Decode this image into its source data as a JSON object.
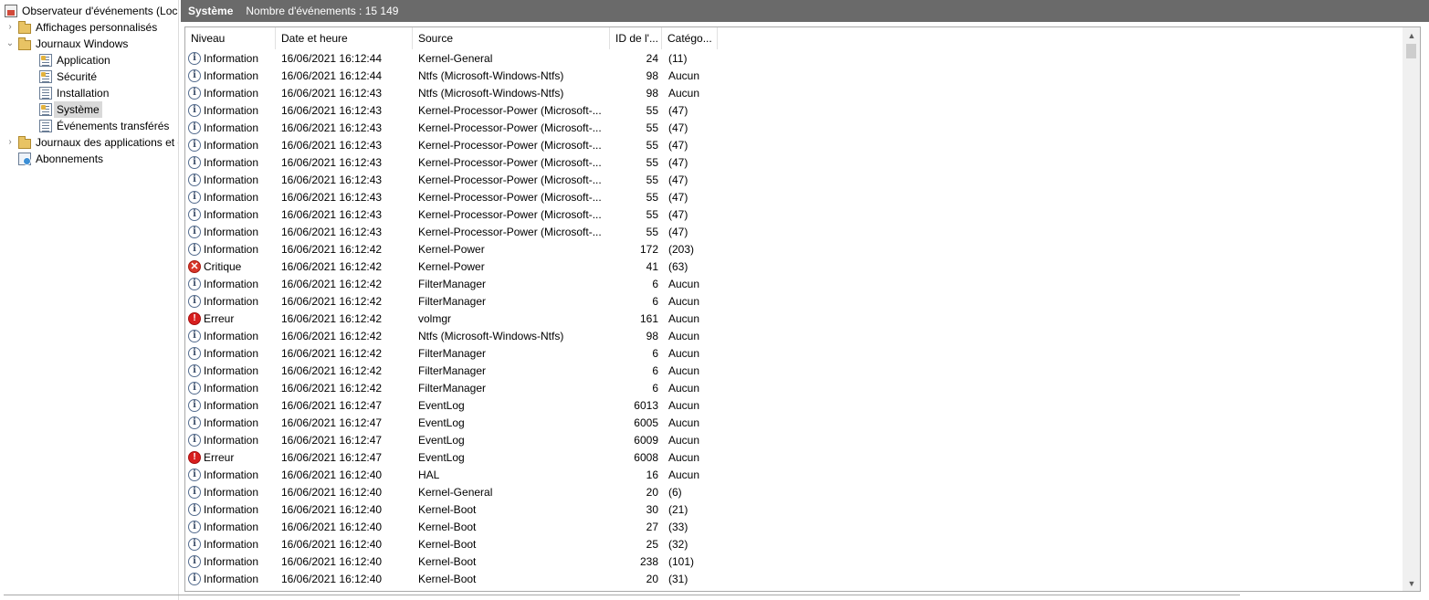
{
  "tree": {
    "items": [
      {
        "label": "Observateur d'événements (Local)",
        "icon": "event-viewer-icon",
        "expander": "",
        "selected": false
      },
      {
        "label": "Affichages personnalisés",
        "icon": "folder-icon",
        "expander": "›",
        "selected": false
      },
      {
        "label": "Journaux Windows",
        "icon": "folder-icon",
        "expander": "⌄",
        "selected": false
      },
      {
        "label": "Application",
        "icon": "log-icon",
        "expander": "",
        "selected": false
      },
      {
        "label": "Sécurité",
        "icon": "log-icon",
        "expander": "",
        "selected": false
      },
      {
        "label": "Installation",
        "icon": "log-icon",
        "expander": "",
        "selected": false
      },
      {
        "label": "Système",
        "icon": "log-icon",
        "expander": "",
        "selected": true
      },
      {
        "label": "Événements transférés",
        "icon": "log-icon",
        "expander": "",
        "selected": false
      },
      {
        "label": "Journaux des applications et des services",
        "icon": "folder-icon",
        "expander": "›",
        "selected": false
      },
      {
        "label": "Abonnements",
        "icon": "subscriptions-icon",
        "expander": "",
        "selected": false
      }
    ]
  },
  "header": {
    "title": "Système",
    "count": "Nombre d'événements : 15 149"
  },
  "columns": {
    "level": "Niveau",
    "date": "Date et heure",
    "source": "Source",
    "id": "ID de l'...",
    "category": "Catégo..."
  },
  "level_icons": {
    "Information": "i",
    "Erreur": "!",
    "Critique": "✕"
  },
  "rows": [
    {
      "level": "Information",
      "date": "16/06/2021 16:12:44",
      "source": "Kernel-General",
      "id": "24",
      "category": "(11)"
    },
    {
      "level": "Information",
      "date": "16/06/2021 16:12:44",
      "source": "Ntfs (Microsoft-Windows-Ntfs)",
      "id": "98",
      "category": "Aucun"
    },
    {
      "level": "Information",
      "date": "16/06/2021 16:12:43",
      "source": "Ntfs (Microsoft-Windows-Ntfs)",
      "id": "98",
      "category": "Aucun"
    },
    {
      "level": "Information",
      "date": "16/06/2021 16:12:43",
      "source": "Kernel-Processor-Power (Microsoft-...",
      "id": "55",
      "category": "(47)"
    },
    {
      "level": "Information",
      "date": "16/06/2021 16:12:43",
      "source": "Kernel-Processor-Power (Microsoft-...",
      "id": "55",
      "category": "(47)"
    },
    {
      "level": "Information",
      "date": "16/06/2021 16:12:43",
      "source": "Kernel-Processor-Power (Microsoft-...",
      "id": "55",
      "category": "(47)"
    },
    {
      "level": "Information",
      "date": "16/06/2021 16:12:43",
      "source": "Kernel-Processor-Power (Microsoft-...",
      "id": "55",
      "category": "(47)"
    },
    {
      "level": "Information",
      "date": "16/06/2021 16:12:43",
      "source": "Kernel-Processor-Power (Microsoft-...",
      "id": "55",
      "category": "(47)"
    },
    {
      "level": "Information",
      "date": "16/06/2021 16:12:43",
      "source": "Kernel-Processor-Power (Microsoft-...",
      "id": "55",
      "category": "(47)"
    },
    {
      "level": "Information",
      "date": "16/06/2021 16:12:43",
      "source": "Kernel-Processor-Power (Microsoft-...",
      "id": "55",
      "category": "(47)"
    },
    {
      "level": "Information",
      "date": "16/06/2021 16:12:43",
      "source": "Kernel-Processor-Power (Microsoft-...",
      "id": "55",
      "category": "(47)"
    },
    {
      "level": "Information",
      "date": "16/06/2021 16:12:42",
      "source": "Kernel-Power",
      "id": "172",
      "category": "(203)"
    },
    {
      "level": "Critique",
      "date": "16/06/2021 16:12:42",
      "source": "Kernel-Power",
      "id": "41",
      "category": "(63)"
    },
    {
      "level": "Information",
      "date": "16/06/2021 16:12:42",
      "source": "FilterManager",
      "id": "6",
      "category": "Aucun"
    },
    {
      "level": "Information",
      "date": "16/06/2021 16:12:42",
      "source": "FilterManager",
      "id": "6",
      "category": "Aucun"
    },
    {
      "level": "Erreur",
      "date": "16/06/2021 16:12:42",
      "source": "volmgr",
      "id": "161",
      "category": "Aucun"
    },
    {
      "level": "Information",
      "date": "16/06/2021 16:12:42",
      "source": "Ntfs (Microsoft-Windows-Ntfs)",
      "id": "98",
      "category": "Aucun"
    },
    {
      "level": "Information",
      "date": "16/06/2021 16:12:42",
      "source": "FilterManager",
      "id": "6",
      "category": "Aucun"
    },
    {
      "level": "Information",
      "date": "16/06/2021 16:12:42",
      "source": "FilterManager",
      "id": "6",
      "category": "Aucun"
    },
    {
      "level": "Information",
      "date": "16/06/2021 16:12:42",
      "source": "FilterManager",
      "id": "6",
      "category": "Aucun"
    },
    {
      "level": "Information",
      "date": "16/06/2021 16:12:47",
      "source": "EventLog",
      "id": "6013",
      "category": "Aucun"
    },
    {
      "level": "Information",
      "date": "16/06/2021 16:12:47",
      "source": "EventLog",
      "id": "6005",
      "category": "Aucun"
    },
    {
      "level": "Information",
      "date": "16/06/2021 16:12:47",
      "source": "EventLog",
      "id": "6009",
      "category": "Aucun"
    },
    {
      "level": "Erreur",
      "date": "16/06/2021 16:12:47",
      "source": "EventLog",
      "id": "6008",
      "category": "Aucun"
    },
    {
      "level": "Information",
      "date": "16/06/2021 16:12:40",
      "source": "HAL",
      "id": "16",
      "category": "Aucun"
    },
    {
      "level": "Information",
      "date": "16/06/2021 16:12:40",
      "source": "Kernel-General",
      "id": "20",
      "category": "(6)"
    },
    {
      "level": "Information",
      "date": "16/06/2021 16:12:40",
      "source": "Kernel-Boot",
      "id": "30",
      "category": "(21)"
    },
    {
      "level": "Information",
      "date": "16/06/2021 16:12:40",
      "source": "Kernel-Boot",
      "id": "27",
      "category": "(33)"
    },
    {
      "level": "Information",
      "date": "16/06/2021 16:12:40",
      "source": "Kernel-Boot",
      "id": "25",
      "category": "(32)"
    },
    {
      "level": "Information",
      "date": "16/06/2021 16:12:40",
      "source": "Kernel-Boot",
      "id": "238",
      "category": "(101)"
    },
    {
      "level": "Information",
      "date": "16/06/2021 16:12:40",
      "source": "Kernel-Boot",
      "id": "20",
      "category": "(31)"
    }
  ]
}
